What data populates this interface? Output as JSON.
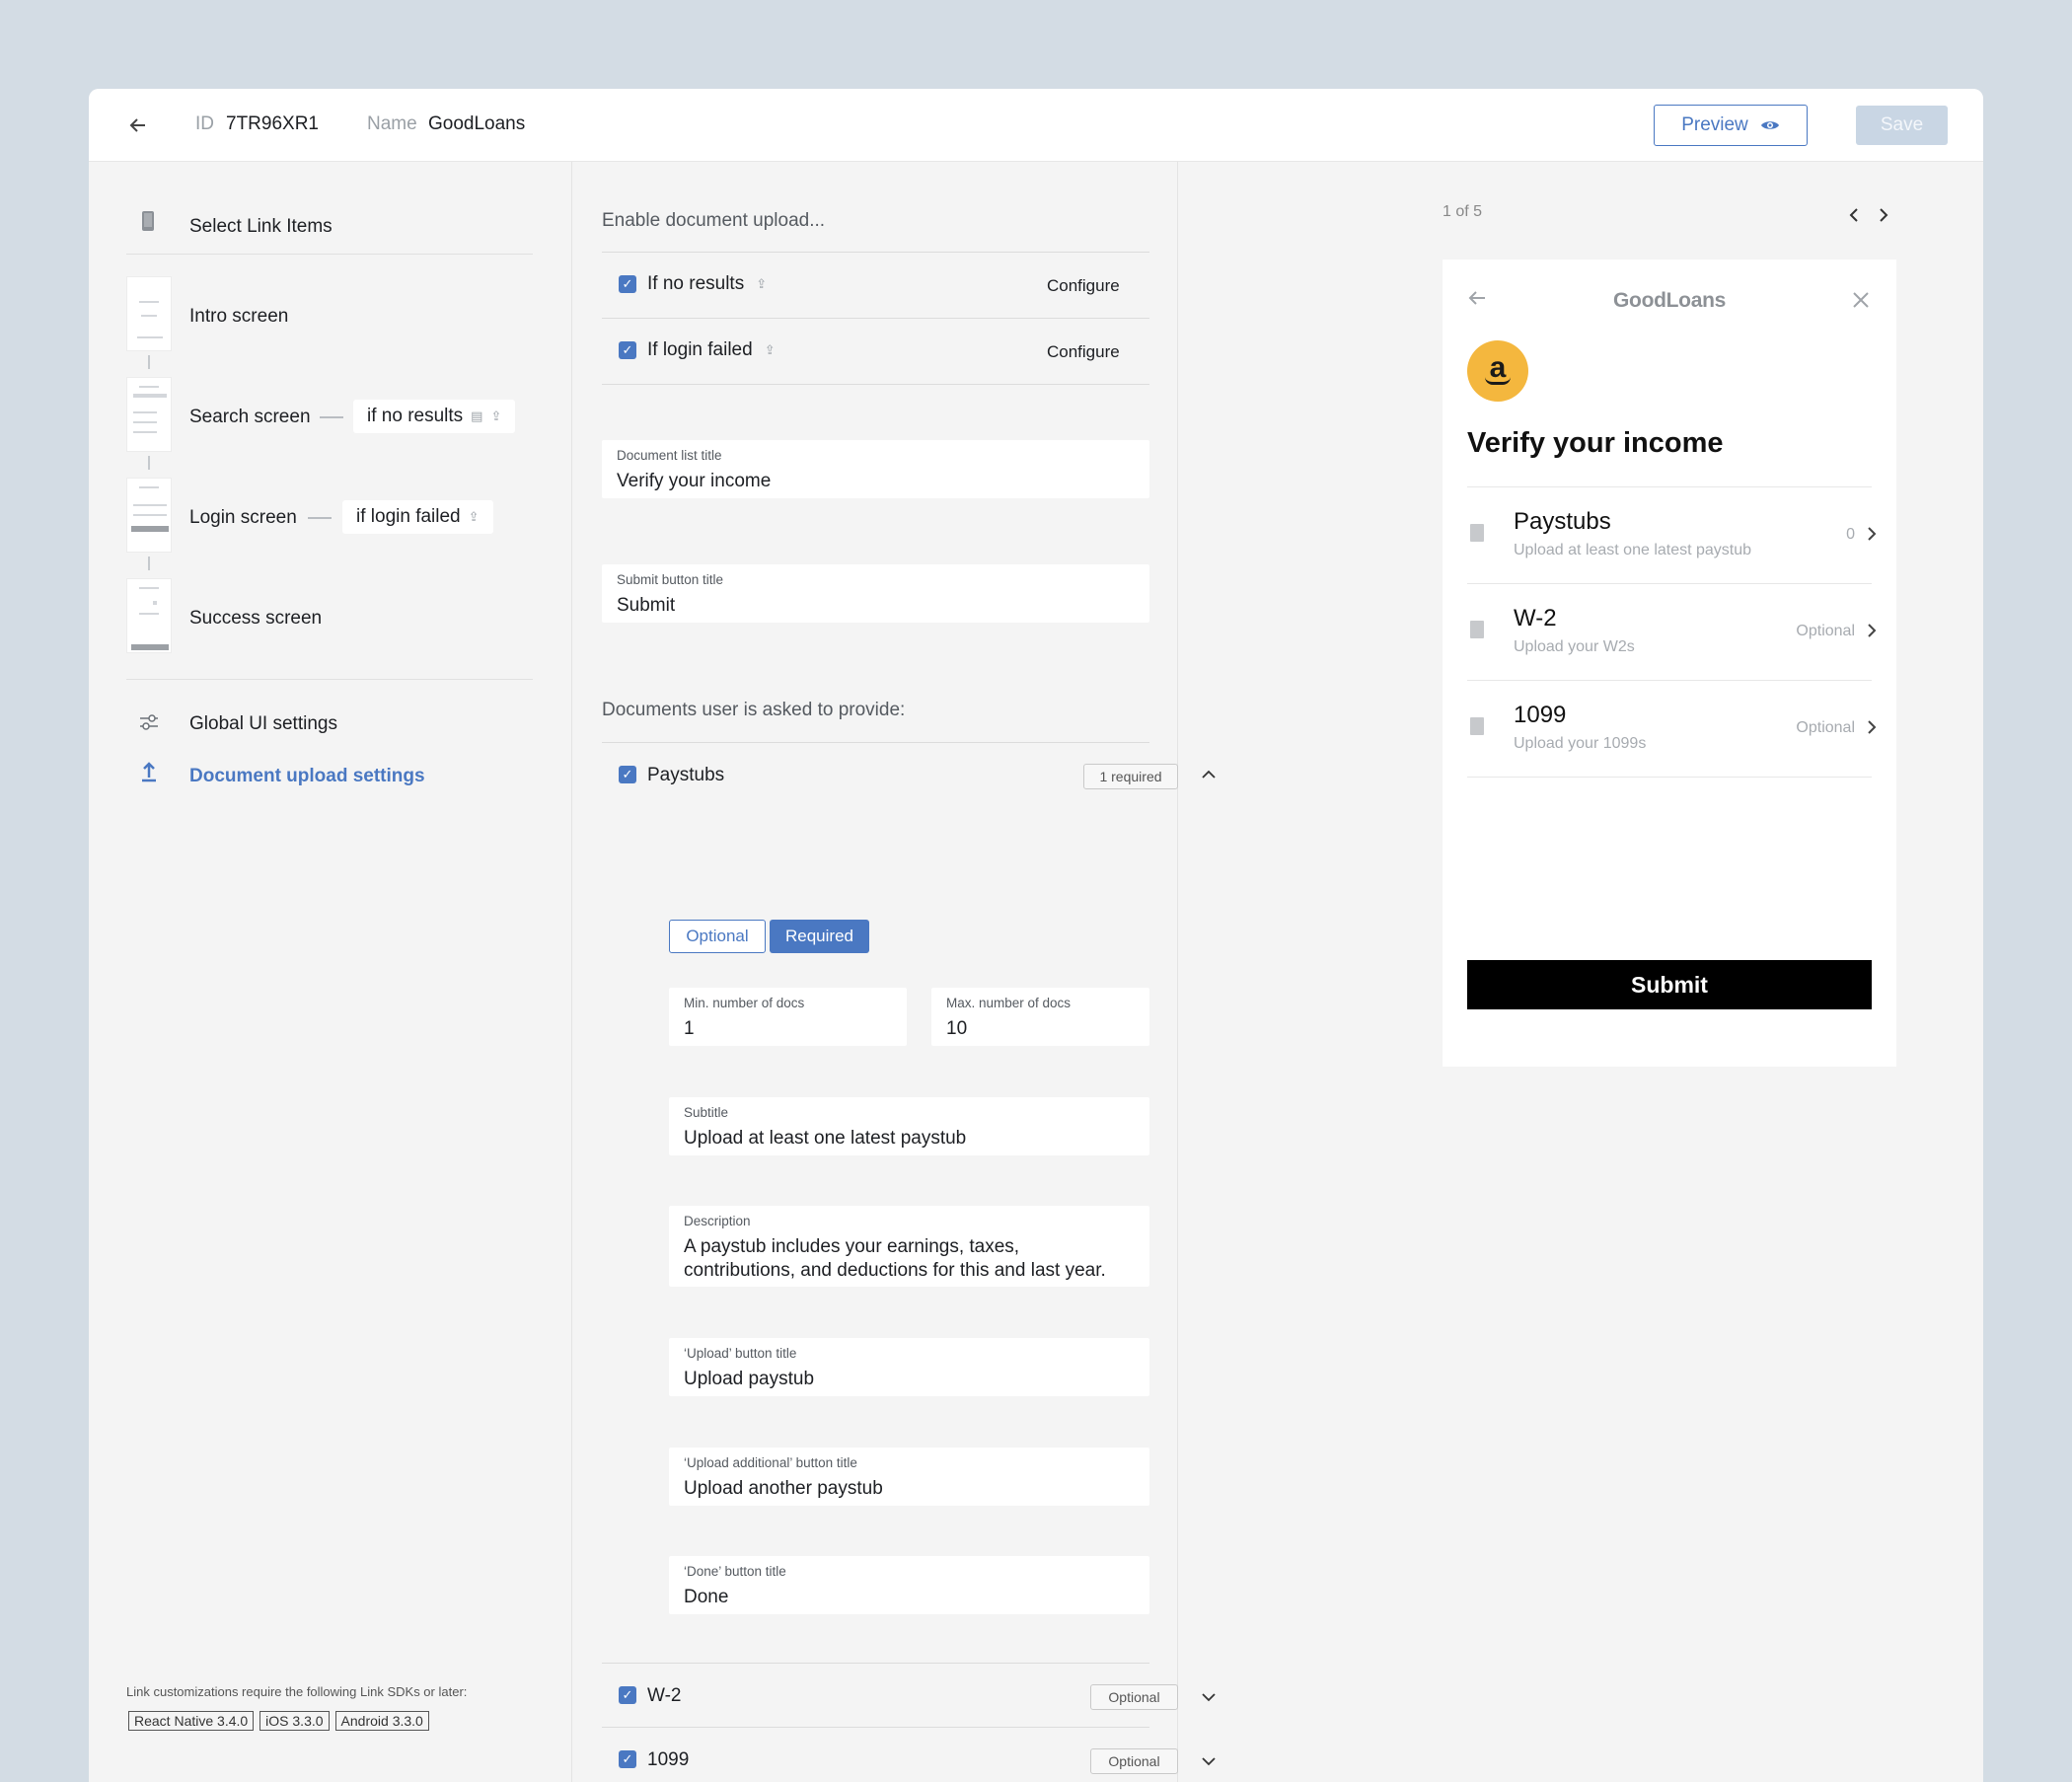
{
  "header": {
    "id_label": "ID",
    "id_value": "7TR96XR1",
    "name_label": "Name",
    "name_value": "GoodLoans",
    "preview_label": "Preview",
    "save_label": "Save"
  },
  "sidebar": {
    "select_items": "Select Link Items",
    "screens": [
      {
        "label": "Intro screen"
      },
      {
        "label": "Search screen",
        "tag": "if no results"
      },
      {
        "label": "Login screen",
        "tag": "if login failed"
      },
      {
        "label": "Success screen"
      }
    ],
    "global_ui": "Global UI settings",
    "doc_upload": "Document upload settings",
    "sdk_note": "Link customizations require the following Link SDKs or later:",
    "sdk_badges": [
      "React Native 3.4.0",
      "iOS 3.3.0",
      "Android 3.3.0"
    ]
  },
  "middle": {
    "enable_heading": "Enable document upload...",
    "triggers": [
      {
        "label": "If no results",
        "action": "Configure"
      },
      {
        "label": "If login failed",
        "action": "Configure"
      }
    ],
    "doc_list_title_label": "Document list title",
    "doc_list_title_value": "Verify your income",
    "submit_title_label": "Submit button title",
    "submit_title_value": "Submit",
    "documents_heading": "Documents user is asked to provide:",
    "paystubs": {
      "name": "Paystubs",
      "badge": "1 required",
      "optional_label": "Optional",
      "required_label": "Required",
      "min_label": "Min. number of docs",
      "min_value": "1",
      "max_label": "Max. number of docs",
      "max_value": "10",
      "subtitle_label": "Subtitle",
      "subtitle_value": "Upload at least one latest paystub",
      "description_label": "Description",
      "description_line1": "A paystub includes your earnings, taxes,",
      "description_line2": "contributions, and deductions for this and last year.",
      "upload_label": "‘Upload’ button title",
      "upload_value": "Upload paystub",
      "upload_additional_label": "‘Upload additional’ button title",
      "upload_additional_value": "Upload another paystub",
      "done_label": "‘Done’ button title",
      "done_value": "Done"
    },
    "w2": {
      "name": "W-2",
      "badge": "Optional"
    },
    "f1099": {
      "name": "1099",
      "badge": "Optional"
    }
  },
  "preview": {
    "page_count": "1 of 5",
    "logo": "GoodLoans",
    "title": "Verify your income",
    "items": [
      {
        "name": "Paystubs",
        "sub": "Upload at least one latest paystub",
        "right": "0"
      },
      {
        "name": "W-2",
        "sub": "Upload your W2s",
        "right": "Optional"
      },
      {
        "name": "1099",
        "sub": "Upload your 1099s",
        "right": "Optional"
      }
    ],
    "submit": "Submit"
  },
  "colors": {
    "accent": "#4a78c2",
    "background": "#d3dce4",
    "amazon": "#f4b73e"
  }
}
